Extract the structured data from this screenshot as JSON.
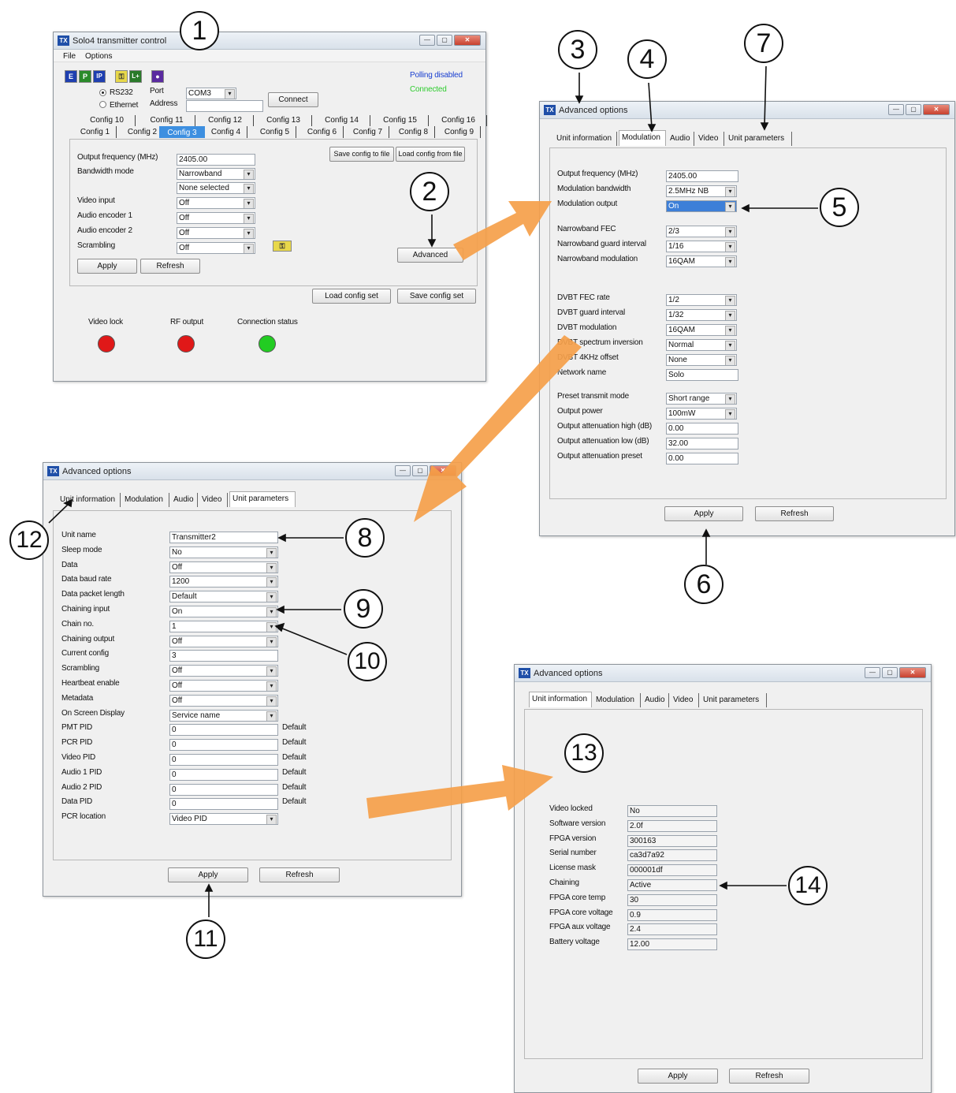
{
  "window1": {
    "title": "Solo4 transmitter control",
    "menu": [
      "File",
      "Options"
    ],
    "toolbar_icons": [
      "E",
      "P",
      "IP",
      "key",
      "L+",
      "circle"
    ],
    "status_polling": "Polling disabled",
    "status_connected": "Connected",
    "radio_rs232": "RS232",
    "radio_ethernet": "Ethernet",
    "port_label": "Port",
    "address_label": "Address",
    "port_value": "COM3",
    "address_value": "",
    "connect_label": "Connect",
    "config_tabs_row1": [
      "Config 10",
      "Config 11",
      "Config 12",
      "Config 13",
      "Config 14",
      "Config 15",
      "Config 16"
    ],
    "config_tabs_row2": [
      "Config 1",
      "Config 2",
      "Config 3",
      "Config 4",
      "Config 5",
      "Config 6",
      "Config 7",
      "Config 8",
      "Config 9"
    ],
    "active_config": "Config 3",
    "fields": [
      {
        "label": "Output frequency (MHz)",
        "value": "2405.00",
        "type": "text"
      },
      {
        "label": "Bandwidth mode",
        "value": "Narrowband",
        "type": "select"
      },
      {
        "label": "",
        "value": "None selected",
        "type": "select"
      },
      {
        "label": "Video input",
        "value": "Off",
        "type": "select"
      },
      {
        "label": "Audio encoder 1",
        "value": "Off",
        "type": "select"
      },
      {
        "label": "Audio encoder 2",
        "value": "Off",
        "type": "select"
      },
      {
        "label": "Scrambling",
        "value": "Off",
        "type": "select"
      }
    ],
    "save_config_file": "Save config to file",
    "load_config_file": "Load config from file",
    "advanced_label": "Advanced",
    "apply_label": "Apply",
    "refresh_label": "Refresh",
    "load_config_set": "Load config set",
    "save_config_set": "Save config set",
    "indicators": [
      {
        "label": "Video lock",
        "color": "#e01818"
      },
      {
        "label": "RF output",
        "color": "#e01818"
      },
      {
        "label": "Connection status",
        "color": "#22cc22"
      }
    ]
  },
  "window2": {
    "title": "Advanced options",
    "tabs": [
      "Unit information",
      "Modulation",
      "Audio",
      "Video",
      "Unit parameters"
    ],
    "active_tab": "Modulation",
    "fields": [
      {
        "label": "Output frequency (MHz)",
        "value": "2405.00",
        "type": "text"
      },
      {
        "label": "Modulation bandwidth",
        "value": "2.5MHz NB",
        "type": "select"
      },
      {
        "label": "Modulation output",
        "value": "On",
        "type": "select",
        "highlight": true
      },
      {
        "label": "Narrowband FEC",
        "value": "2/3",
        "type": "select"
      },
      {
        "label": "Narrowband guard interval",
        "value": "1/16",
        "type": "select"
      },
      {
        "label": "Narrowband modulation",
        "value": "16QAM",
        "type": "select"
      },
      {
        "label": "DVBT FEC rate",
        "value": "1/2",
        "type": "select"
      },
      {
        "label": "DVBT guard interval",
        "value": "1/32",
        "type": "select"
      },
      {
        "label": "DVBT modulation",
        "value": "16QAM",
        "type": "select"
      },
      {
        "label": "DVBT spectrum inversion",
        "value": "Normal",
        "type": "select"
      },
      {
        "label": "DVBT 4KHz offset",
        "value": "None",
        "type": "select"
      },
      {
        "label": "Network name",
        "value": "Solo",
        "type": "text"
      },
      {
        "label": "Preset transmit mode",
        "value": "Short range",
        "type": "select"
      },
      {
        "label": "Output power",
        "value": "100mW",
        "type": "select"
      },
      {
        "label": "Output attenuation high (dB)",
        "value": "0.00",
        "type": "text"
      },
      {
        "label": "Output attenuation low (dB)",
        "value": "32.00",
        "type": "text"
      },
      {
        "label": "Output attenuation preset",
        "value": "0.00",
        "type": "text"
      }
    ],
    "apply_label": "Apply",
    "refresh_label": "Refresh"
  },
  "window3": {
    "title": "Advanced options",
    "tabs": [
      "Unit information",
      "Modulation",
      "Audio",
      "Video",
      "Unit parameters"
    ],
    "active_tab": "Unit parameters",
    "fields": [
      {
        "label": "Unit name",
        "value": "Transmitter2",
        "type": "text",
        "suffix": ""
      },
      {
        "label": "Sleep mode",
        "value": "No",
        "type": "select",
        "suffix": ""
      },
      {
        "label": "Data",
        "value": "Off",
        "type": "select",
        "suffix": ""
      },
      {
        "label": "Data baud rate",
        "value": "1200",
        "type": "select",
        "suffix": ""
      },
      {
        "label": "Data packet length",
        "value": "Default",
        "type": "select",
        "suffix": ""
      },
      {
        "label": "Chaining input",
        "value": "On",
        "type": "select",
        "suffix": ""
      },
      {
        "label": "Chain no.",
        "value": "1",
        "type": "select",
        "suffix": ""
      },
      {
        "label": "Chaining output",
        "value": "Off",
        "type": "select",
        "suffix": ""
      },
      {
        "label": "Current config",
        "value": "3",
        "type": "text",
        "suffix": ""
      },
      {
        "label": "Scrambling",
        "value": "Off",
        "type": "select",
        "suffix": ""
      },
      {
        "label": "Heartbeat enable",
        "value": "Off",
        "type": "select",
        "suffix": ""
      },
      {
        "label": "Metadata",
        "value": "Off",
        "type": "select",
        "suffix": ""
      },
      {
        "label": "On Screen Display",
        "value": "Service name",
        "type": "select",
        "suffix": ""
      },
      {
        "label": "PMT PID",
        "value": "0",
        "type": "text",
        "suffix": "Default"
      },
      {
        "label": "PCR PID",
        "value": "0",
        "type": "text",
        "suffix": "Default"
      },
      {
        "label": "Video PID",
        "value": "0",
        "type": "text",
        "suffix": "Default"
      },
      {
        "label": "Audio 1 PID",
        "value": "0",
        "type": "text",
        "suffix": "Default"
      },
      {
        "label": "Audio 2 PID",
        "value": "0",
        "type": "text",
        "suffix": "Default"
      },
      {
        "label": "Data PID",
        "value": "0",
        "type": "text",
        "suffix": "Default"
      },
      {
        "label": "PCR location",
        "value": "Video PID",
        "type": "select",
        "suffix": ""
      }
    ],
    "apply_label": "Apply",
    "refresh_label": "Refresh"
  },
  "window4": {
    "title": "Advanced options",
    "tabs": [
      "Unit information",
      "Modulation",
      "Audio",
      "Video",
      "Unit parameters"
    ],
    "active_tab": "Unit information",
    "fields": [
      {
        "label": "Video locked",
        "value": "No"
      },
      {
        "label": "Software version",
        "value": "2.0f"
      },
      {
        "label": "FPGA version",
        "value": "300163"
      },
      {
        "label": "Serial number",
        "value": "ca3d7a92"
      },
      {
        "label": "License mask",
        "value": "000001df"
      },
      {
        "label": "Chaining",
        "value": "Active"
      },
      {
        "label": "FPGA core temp",
        "value": "30"
      },
      {
        "label": "FPGA core voltage",
        "value": "0.9"
      },
      {
        "label": "FPGA aux voltage",
        "value": "2.4"
      },
      {
        "label": "Battery voltage",
        "value": "12.00"
      }
    ],
    "apply_label": "Apply",
    "refresh_label": "Refresh"
  },
  "callouts": [
    "1",
    "2",
    "3",
    "4",
    "5",
    "6",
    "7",
    "8",
    "9",
    "10",
    "11",
    "12",
    "13",
    "14"
  ],
  "colors": {
    "arrow": "#f5a04a",
    "accent": "#3d8fe0",
    "led_red": "#e01818",
    "led_green": "#22cc22",
    "polling": "#1a3fd0",
    "connected": "#2fcc2f"
  }
}
